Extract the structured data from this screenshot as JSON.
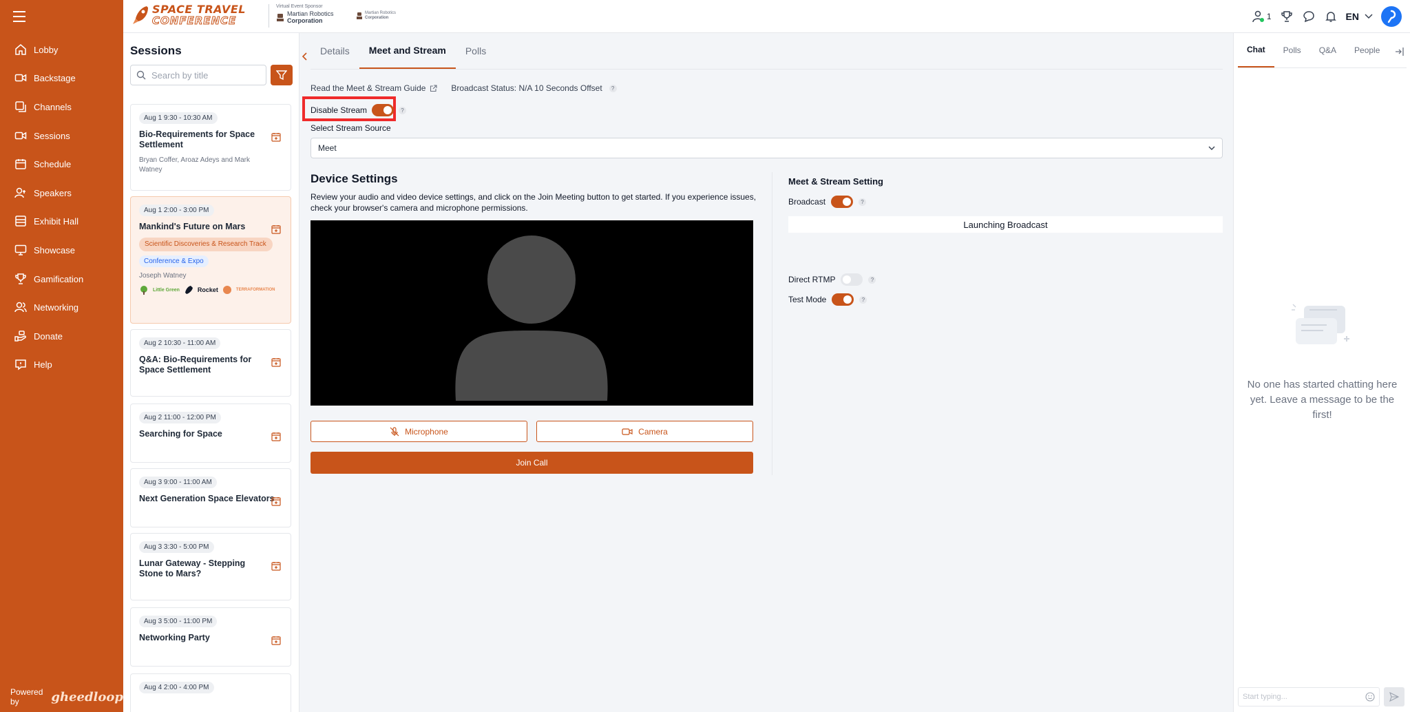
{
  "brand": {
    "line1": "SPACE TRAVEL",
    "line2": "CONFERENCE",
    "sponsor_caption": "Virtual Event Sponsor",
    "sponsor_name1": "Martian Robotics",
    "sponsor_name2": "Corporation",
    "sponsor2_name1": "Martian Robotics",
    "sponsor2_name2": "Corporation"
  },
  "topbar": {
    "online_count": "1",
    "language": "EN"
  },
  "nav": {
    "items": [
      {
        "label": "Lobby",
        "icon": "home-icon"
      },
      {
        "label": "Backstage",
        "icon": "video-icon"
      },
      {
        "label": "Channels",
        "icon": "channels-icon"
      },
      {
        "label": "Sessions",
        "icon": "sessions-icon"
      },
      {
        "label": "Schedule",
        "icon": "calendar-icon"
      },
      {
        "label": "Speakers",
        "icon": "speakers-icon"
      },
      {
        "label": "Exhibit Hall",
        "icon": "exhibit-icon"
      },
      {
        "label": "Showcase",
        "icon": "showcase-icon"
      },
      {
        "label": "Gamification",
        "icon": "trophy-icon"
      },
      {
        "label": "Networking",
        "icon": "networking-icon"
      },
      {
        "label": "Donate",
        "icon": "donate-icon"
      },
      {
        "label": "Help",
        "icon": "help-icon"
      }
    ],
    "powered_by": "Powered by",
    "powered_logo": "gheedloop"
  },
  "sessions": {
    "title": "Sessions",
    "search_placeholder": "Search by title",
    "items": [
      {
        "time": "Aug 1 9:30 - 10:30 AM",
        "title": "Bio-Requirements for Space Settlement",
        "speakers": "Bryan Coffer, Aroaz Adeys and Mark Watney"
      },
      {
        "time": "Aug 1 2:00 - 3:00 PM",
        "title": "Mankind's Future on Mars",
        "track": "Scientific Discoveries & Research Track",
        "tag": "Conference & Expo",
        "speakers": "Joseph Watney",
        "sponsor_a": "Little Green",
        "sponsor_b": "Rocket",
        "sponsor_c": "TERRAFORMATION"
      },
      {
        "time": "Aug 2 10:30 - 11:00 AM",
        "title": "Q&A: Bio-Requirements for Space Settlement"
      },
      {
        "time": "Aug 2 11:00 - 12:00 PM",
        "title": "Searching for Space"
      },
      {
        "time": "Aug 3 9:00 - 11:00 AM",
        "title": "Next Generation Space Elevators"
      },
      {
        "time": "Aug 3 3:30 - 5:00 PM",
        "title": "Lunar Gateway - Stepping Stone to Mars?"
      },
      {
        "time": "Aug 3 5:00 - 11:00 PM",
        "title": "Networking Party"
      },
      {
        "time": "Aug 4 2:00 - 4:00 PM",
        "title": ""
      }
    ]
  },
  "main": {
    "tabs": [
      "Details",
      "Meet and Stream",
      "Polls"
    ],
    "guide_link": "Read the Meet & Stream Guide",
    "broadcast_status": "Broadcast Status: N/A 10 Seconds Offset",
    "disable_stream": "Disable Stream",
    "stream_source_label": "Select Stream Source",
    "stream_source_value": "Meet",
    "device_title": "Device Settings",
    "device_desc": "Review your audio and video device settings, and click on the Join Meeting button to get started. If you experience issues, check your browser's camera and microphone permissions.",
    "microphone": "Microphone",
    "camera": "Camera",
    "join": "Join Call",
    "ms_title": "Meet & Stream Setting",
    "broadcast": "Broadcast",
    "launching": "Launching Broadcast",
    "direct_rtmp": "Direct RTMP",
    "test_mode": "Test Mode"
  },
  "chat": {
    "tabs": [
      "Chat",
      "Polls",
      "Q&A",
      "People"
    ],
    "empty": "No one has started chatting here yet. Leave a message to be the first!",
    "input_placeholder": "Start typing..."
  },
  "colors": {
    "accent": "#c8541a",
    "highlight": "#ef2b2b"
  }
}
